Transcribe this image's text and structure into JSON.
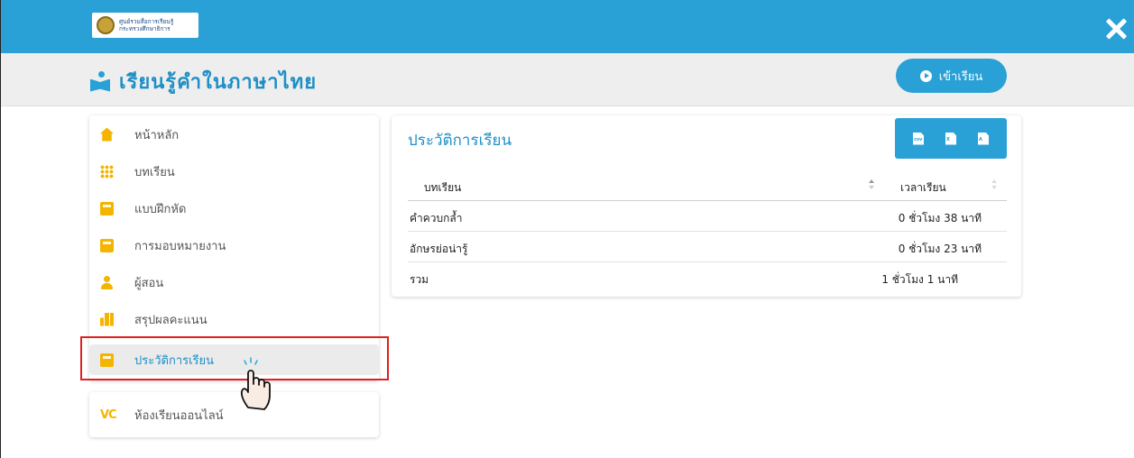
{
  "topbar": {
    "logo_line1": "ศูนย์รวมสื่อการเรียนรู้",
    "logo_line2": "กระทรวงศึกษาธิการ",
    "brand_color": "#29a0d6"
  },
  "header": {
    "title": "เรียนรู้คำในภาษาไทย",
    "enter_label": "เข้าเรียน"
  },
  "sidebar": {
    "items": [
      {
        "label": "หน้าหลัก",
        "icon": "home-icon"
      },
      {
        "label": "บทเรียน",
        "icon": "grid-icon"
      },
      {
        "label": "แบบฝึกหัด",
        "icon": "calculator-icon"
      },
      {
        "label": "การมอบหมายงาน",
        "icon": "calculator-icon"
      },
      {
        "label": "ผู้สอน",
        "icon": "user-icon"
      },
      {
        "label": "สรุปผลคะแนน",
        "icon": "bar-chart-icon"
      },
      {
        "label": "ประวัติการเรียน",
        "icon": "calculator-icon",
        "active": true
      }
    ]
  },
  "online_class": {
    "logo": "VC",
    "label": "ห้องเรียนออนไลน์"
  },
  "history": {
    "title": "ประวัติการเรียน",
    "export_icons": [
      "csv-file-icon",
      "excel-file-icon",
      "pdf-file-icon"
    ],
    "columns": [
      "บทเรียน",
      "เวลาเรียน"
    ],
    "rows": [
      {
        "lesson": "คำควบกล้ำ",
        "time": "0 ชั่วโมง 38 นาที"
      },
      {
        "lesson": "อักษรย่อน่ารู้",
        "time": "0 ชั่วโมง 23 นาที"
      }
    ],
    "total_label": "รวม",
    "total_time": "1 ชั่วโมง 1 นาที"
  },
  "highlight_color": "#e02020"
}
